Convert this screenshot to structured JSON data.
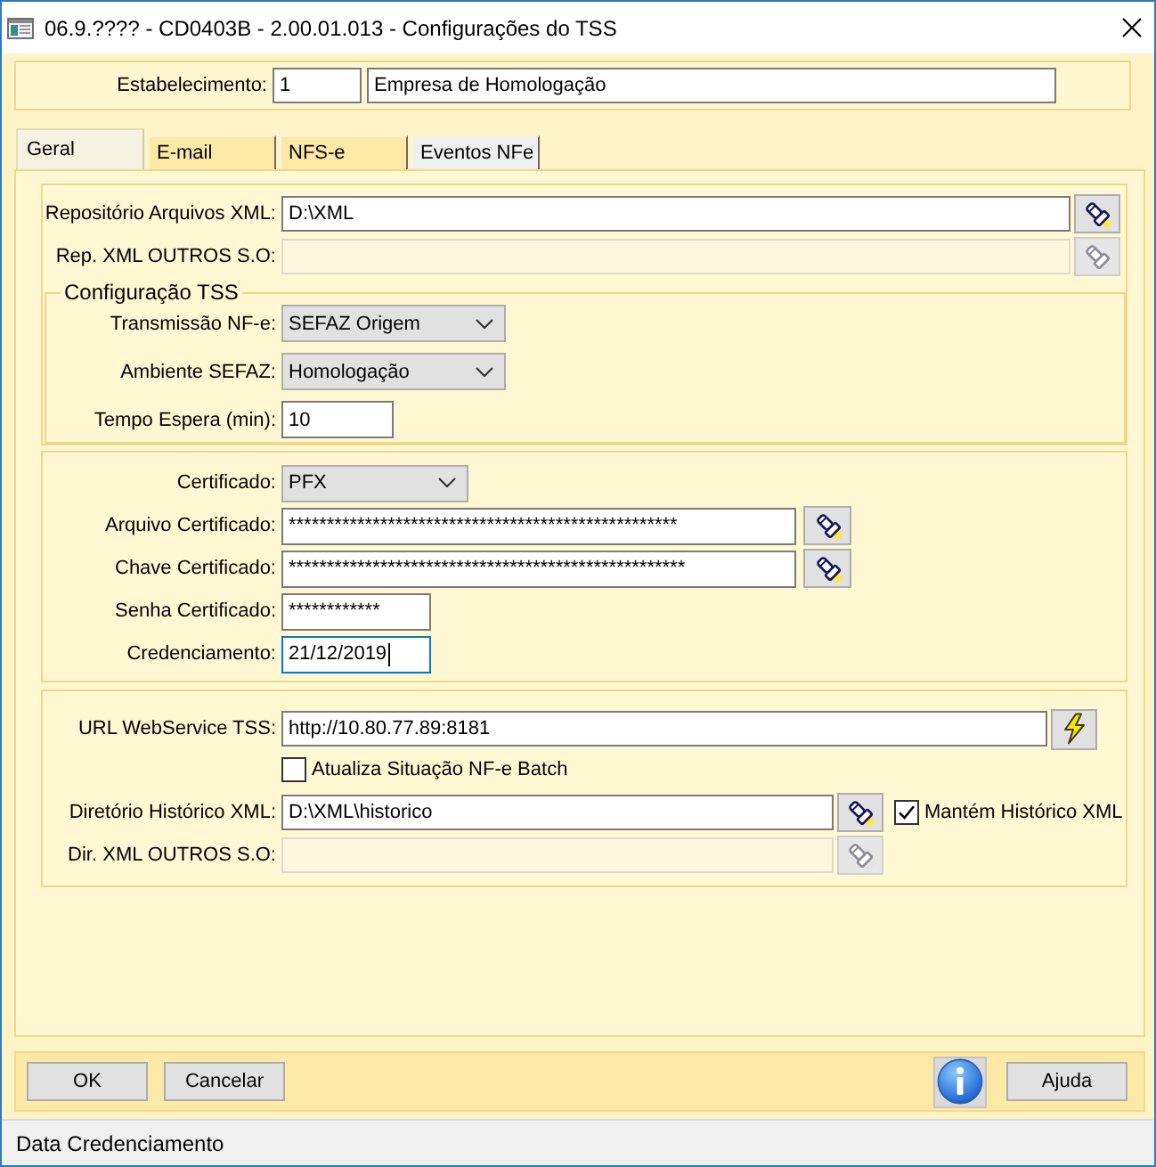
{
  "window": {
    "title": "06.9.???? - CD0403B - 2.00.01.013 - Configurações do TSS"
  },
  "establishment": {
    "label": "Estabelecimento:",
    "code": "1",
    "name": "Empresa de Homologação"
  },
  "tabs": [
    {
      "label": "Geral",
      "selected": true,
      "color": "#f5f2e2"
    },
    {
      "label": "E-mail",
      "selected": false,
      "color": "#fde8a5"
    },
    {
      "label": "NFS-e",
      "selected": false,
      "color": "#fde8a5"
    },
    {
      "label": "Eventos NFe",
      "selected": false,
      "color": "#efefef"
    }
  ],
  "repository": {
    "rows": [
      {
        "label": "Repositório Arquivos XML:",
        "value": "D:\\XML",
        "disabled": false
      },
      {
        "label": "Rep. XML OUTROS S.O:",
        "disabled": true
      }
    ]
  },
  "tss_config": {
    "title": "Configuração TSS",
    "rows": [
      {
        "kind": "select",
        "label": "Transmissão NF-e:",
        "value": "SEFAZ Origem"
      },
      {
        "kind": "select",
        "label": "Ambiente SEFAZ:",
        "value": "Homologação"
      },
      {
        "kind": "input",
        "label": "Tempo Espera (min):",
        "value": "10",
        "focused": false
      }
    ]
  },
  "certificate": {
    "rows": [
      {
        "kind": "select",
        "label": "Certificado:",
        "value": "PFX"
      },
      {
        "kind": "browse",
        "label": "Arquivo Certificado:",
        "value": "***************************************************",
        "disabled": false
      },
      {
        "kind": "browse",
        "label": "Chave Certificado:",
        "value": "****************************************************",
        "disabled": false
      },
      {
        "kind": "input",
        "label": "Senha Certificado:",
        "value": "************",
        "focused": false
      },
      {
        "kind": "input",
        "label": "Credenciamento:",
        "value": "21/12/2019",
        "focused": true
      }
    ]
  },
  "webservice": {
    "url": {
      "label": "URL WebService TSS:",
      "value": "http://10.80.77.89:8181"
    },
    "batch": {
      "label": "Atualiza Situação NF-e Batch",
      "checked": false
    },
    "history": {
      "label": "Diretório Histórico XML:",
      "value": "D:\\XML\\historico",
      "disabled": false
    },
    "keep_history": {
      "label": "Mantém Histórico XML",
      "checked": true
    },
    "other": {
      "label": "Dir. XML OUTROS S.O:",
      "disabled": true
    }
  },
  "buttons": {
    "actions": [
      "OK",
      "Cancelar"
    ],
    "help": "Ajuda"
  },
  "status_bar": {
    "text": "Data Credenciamento"
  }
}
